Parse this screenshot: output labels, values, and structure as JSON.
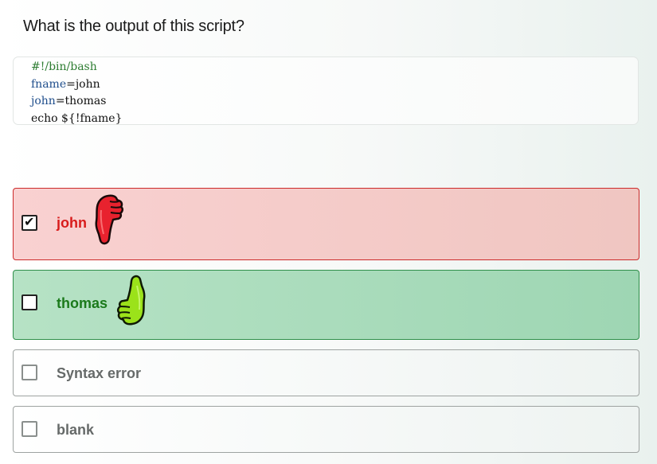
{
  "question": "What is the output of this script?",
  "code": {
    "comment": "#!/bin/bash",
    "line2_var": "fname",
    "line2_rest": "=john",
    "line3_var": "john",
    "line3_rest": "=thomas",
    "line4": "echo ${!fname}"
  },
  "options": [
    {
      "label": "john",
      "checked": true,
      "state": "wrong",
      "icon": "thumbs-down-icon"
    },
    {
      "label": "thomas",
      "checked": false,
      "state": "correct",
      "icon": "thumbs-up-icon"
    },
    {
      "label": "Syntax error",
      "checked": false,
      "state": "neutral"
    },
    {
      "label": "blank",
      "checked": false,
      "state": "neutral"
    }
  ],
  "colors": {
    "wrong": "#d81b1b",
    "correct": "#1b7a1b",
    "thumb_down": "#e8222e",
    "thumb_up": "#9be21a"
  }
}
